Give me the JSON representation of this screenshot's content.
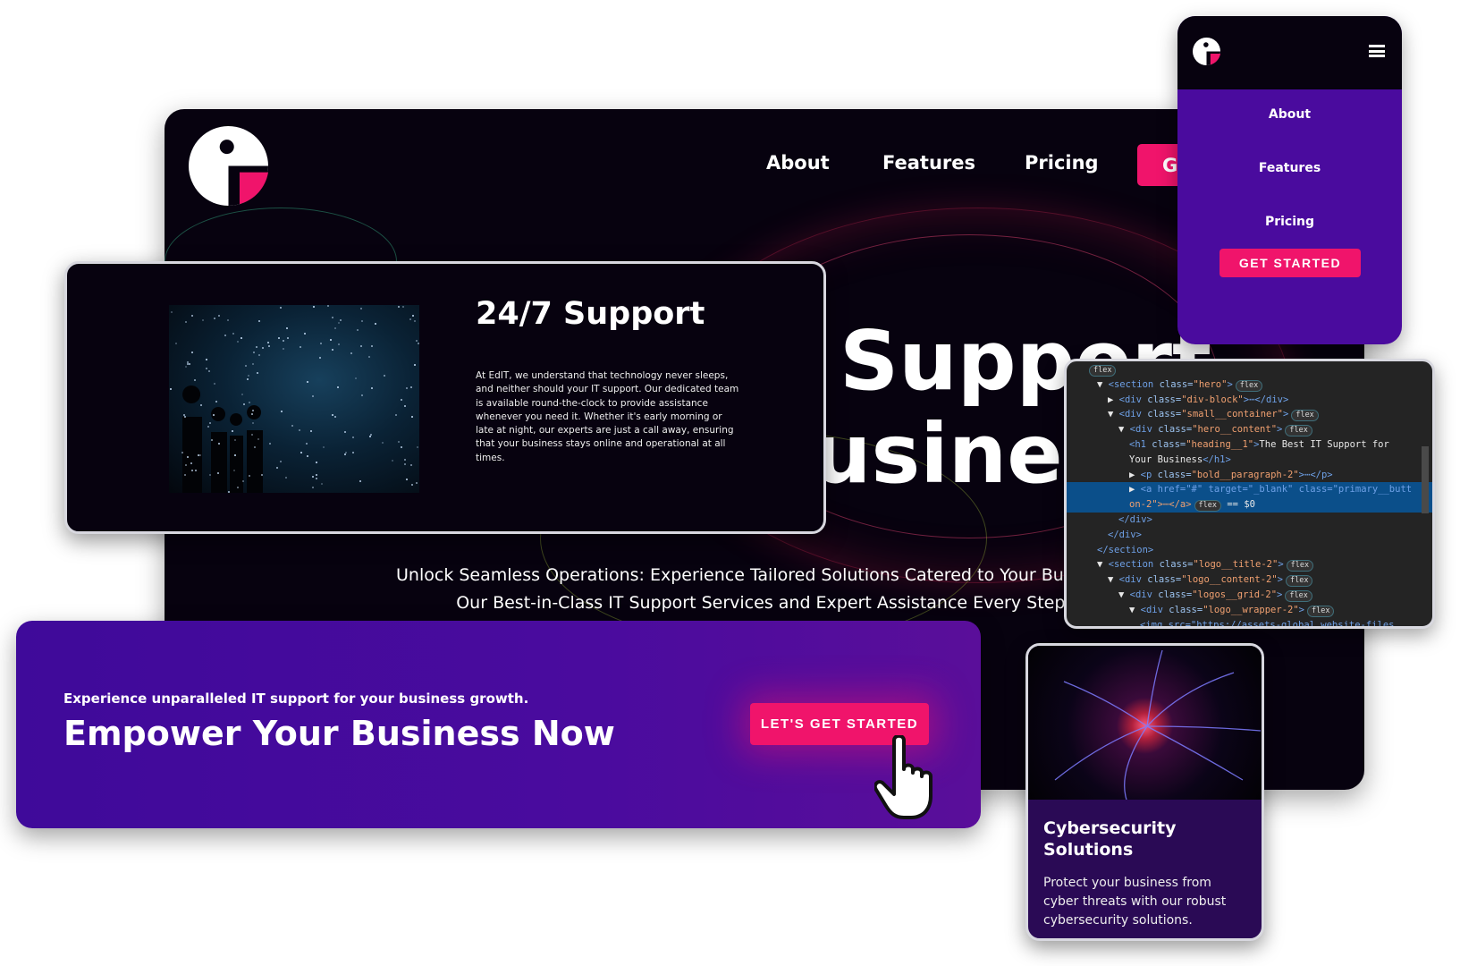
{
  "colors": {
    "accent": "#f0146b",
    "purple": "#4a0b9e",
    "dark": "#07020f"
  },
  "desktop": {
    "nav": [
      {
        "label": "About"
      },
      {
        "label": "Features"
      },
      {
        "label": "Pricing"
      }
    ],
    "nav_button_partial": "G",
    "hero_title_lines": [
      "Support",
      "usines"
    ],
    "subtitle_lines": [
      "Unlock Seamless Operations: Experience Tailored Solutions Catered to Your Busi",
      "Our Best-in-Class IT Support Services and Expert Assistance Every Step of"
    ]
  },
  "support_card": {
    "title": "24/7 Support",
    "body": "At EdIT, we understand that technology never sleeps, and neither should your IT support. Our dedicated team is available round-the-clock to provide assistance whenever you need it. Whether it's early morning or late at night, our experts are just a call away, ensuring that your business stays online and operational at all times."
  },
  "cta": {
    "kicker": "Experience unparalleled IT support for your business growth.",
    "heading": "Empower Your Business Now",
    "button": "LET'S GET STARTED"
  },
  "mobile": {
    "menu_icon": "hamburger-icon",
    "items": [
      {
        "label": "About"
      },
      {
        "label": "Features"
      },
      {
        "label": "Pricing"
      }
    ],
    "button": "GET STARTED"
  },
  "devtools": {
    "lines": [
      {
        "indent": 0,
        "html": "",
        "badge": "flex"
      },
      {
        "indent": 1,
        "arrow": "▼",
        "tag": "section",
        "cls": "hero",
        "badge": "flex"
      },
      {
        "indent": 2,
        "arrow": "▶",
        "tag": "div",
        "cls": "div-block",
        "tail": "⋯</div>"
      },
      {
        "indent": 2,
        "arrow": "▼",
        "tag": "div",
        "cls": "small__container",
        "badge": "flex"
      },
      {
        "indent": 3,
        "arrow": "▼",
        "tag": "div",
        "cls": "hero__content",
        "badge": "flex"
      },
      {
        "indent": 4,
        "tag": "h1",
        "cls": "heading__1",
        "text": "The Best IT Support for"
      },
      {
        "indent": 4,
        "text": "Your Business",
        "close": "</h1>"
      },
      {
        "indent": 4,
        "arrow": "▶",
        "tag": "p",
        "cls": "bold__paragraph-2",
        "tail": "⋯</p>"
      },
      {
        "indent": 4,
        "arrow": "▶",
        "raw": "<a href=\"#\" target=\"_blank\" class=\"primary__butt",
        "selected": true
      },
      {
        "indent": 4,
        "raw": "on-2\">⋯</a>",
        "badge": "flex",
        "after": " == $0",
        "selected": true
      },
      {
        "indent": 3,
        "raw": "</div>"
      },
      {
        "indent": 2,
        "raw": "</div>"
      },
      {
        "indent": 1,
        "raw": "</section>"
      },
      {
        "indent": 1,
        "arrow": "▼",
        "tag": "section",
        "cls": "logo__title-2",
        "badge": "flex"
      },
      {
        "indent": 2,
        "arrow": "▼",
        "tag": "div",
        "cls": "logo__content-2",
        "badge": "flex"
      },
      {
        "indent": 3,
        "arrow": "▼",
        "tag": "div",
        "cls": "logos__grid-2",
        "badge": "flex"
      },
      {
        "indent": 4,
        "arrow": "▼",
        "tag": "div",
        "cls": "logo__wrapper-2",
        "badge": "flex"
      },
      {
        "indent": 5,
        "raw": "<img src=\"https://assets-global.website-files"
      }
    ]
  },
  "cyber_card": {
    "title": "Cybersecurity Solutions",
    "body": "Protect your business from cyber threats with our robust cybersecurity solutions."
  }
}
